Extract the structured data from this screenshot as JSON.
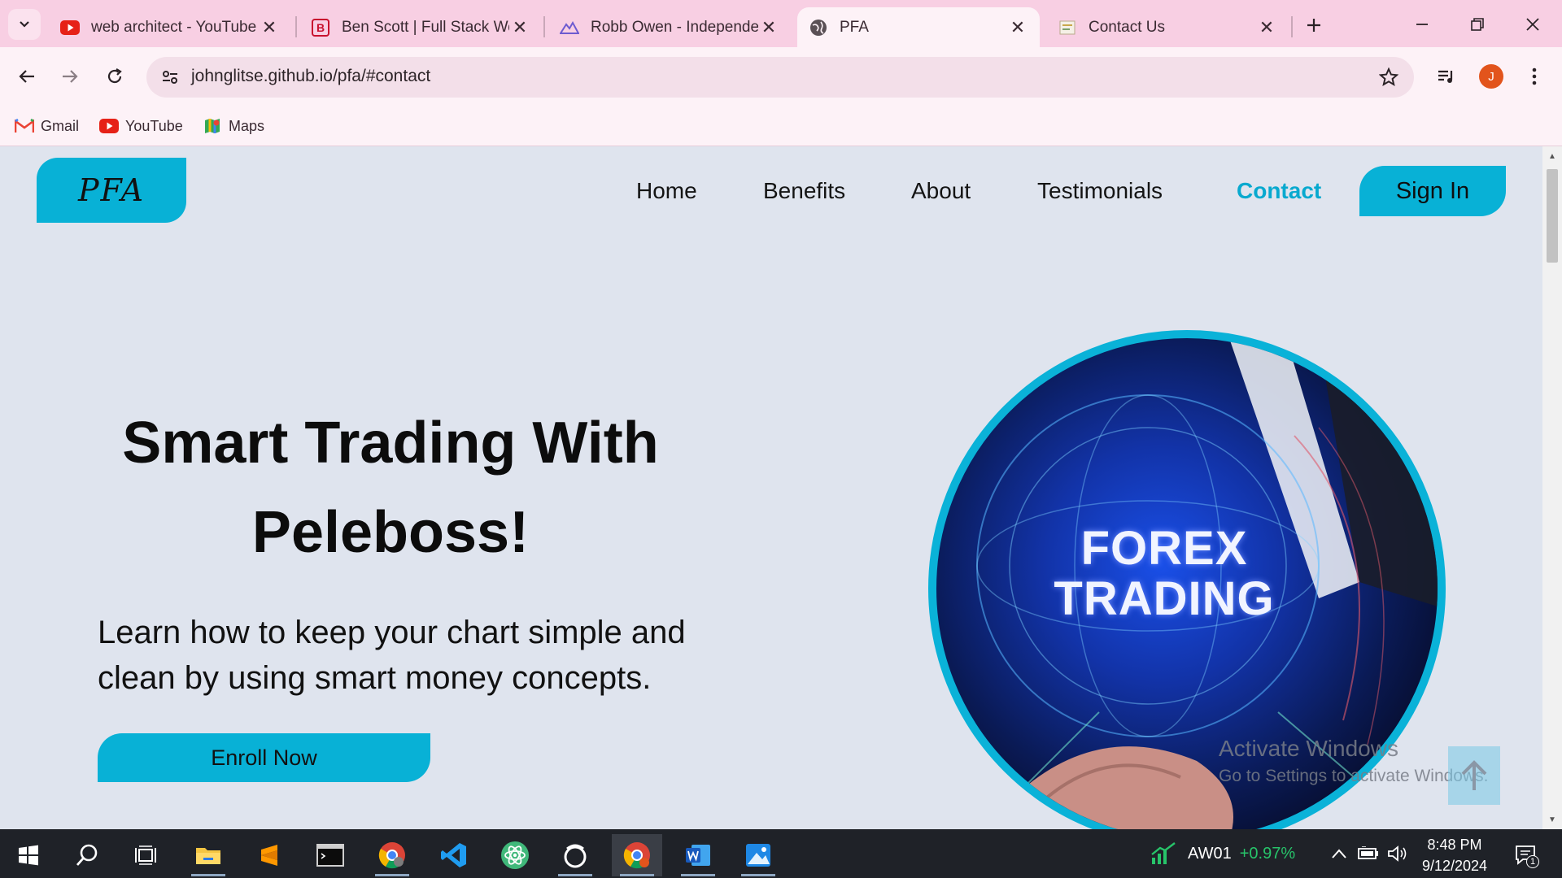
{
  "browser": {
    "tabs": [
      {
        "title": "web architect - YouTube",
        "icon": "youtube-icon"
      },
      {
        "title": "Ben Scott | Full Stack Web",
        "icon": "bs-logo-icon"
      },
      {
        "title": "Robb Owen - Independent",
        "icon": "mountain-icon"
      },
      {
        "title": "PFA",
        "icon": "globe-icon",
        "active": true
      },
      {
        "title": "Contact Us",
        "icon": "page-icon"
      }
    ],
    "url": "johnglitse.github.io/pfa/#contact",
    "avatar_letter": "J",
    "bookmarks": [
      {
        "label": "Gmail",
        "icon": "gmail-icon"
      },
      {
        "label": "YouTube",
        "icon": "youtube-icon"
      },
      {
        "label": "Maps",
        "icon": "maps-icon"
      }
    ]
  },
  "site": {
    "logo": "PFA",
    "nav": [
      "Home",
      "Benefits",
      "About",
      "Testimonials",
      "Contact"
    ],
    "active_nav": "Contact",
    "signin": "Sign In",
    "hero": {
      "title_line1": "Smart Trading With",
      "title_line2": "Peleboss!",
      "text": "Learn how to keep your chart simple and clean by using smart money concepts.",
      "cta": "Enroll Now",
      "image_caption_line1": "FOREX",
      "image_caption_line2": "TRADING"
    }
  },
  "watermark": {
    "line1": "Activate Windows",
    "line2": "Go to Settings to activate Windows."
  },
  "taskbar": {
    "ticker_symbol": "AW01",
    "ticker_change": "+0.97%",
    "time": "8:48 PM",
    "date": "9/12/2024",
    "notification_count": "1"
  },
  "colors": {
    "accent": "#08b1d6",
    "tabbar": "#f8cfe3",
    "page_bg": "#dfe4ee",
    "ticker_up": "#27c46a"
  }
}
